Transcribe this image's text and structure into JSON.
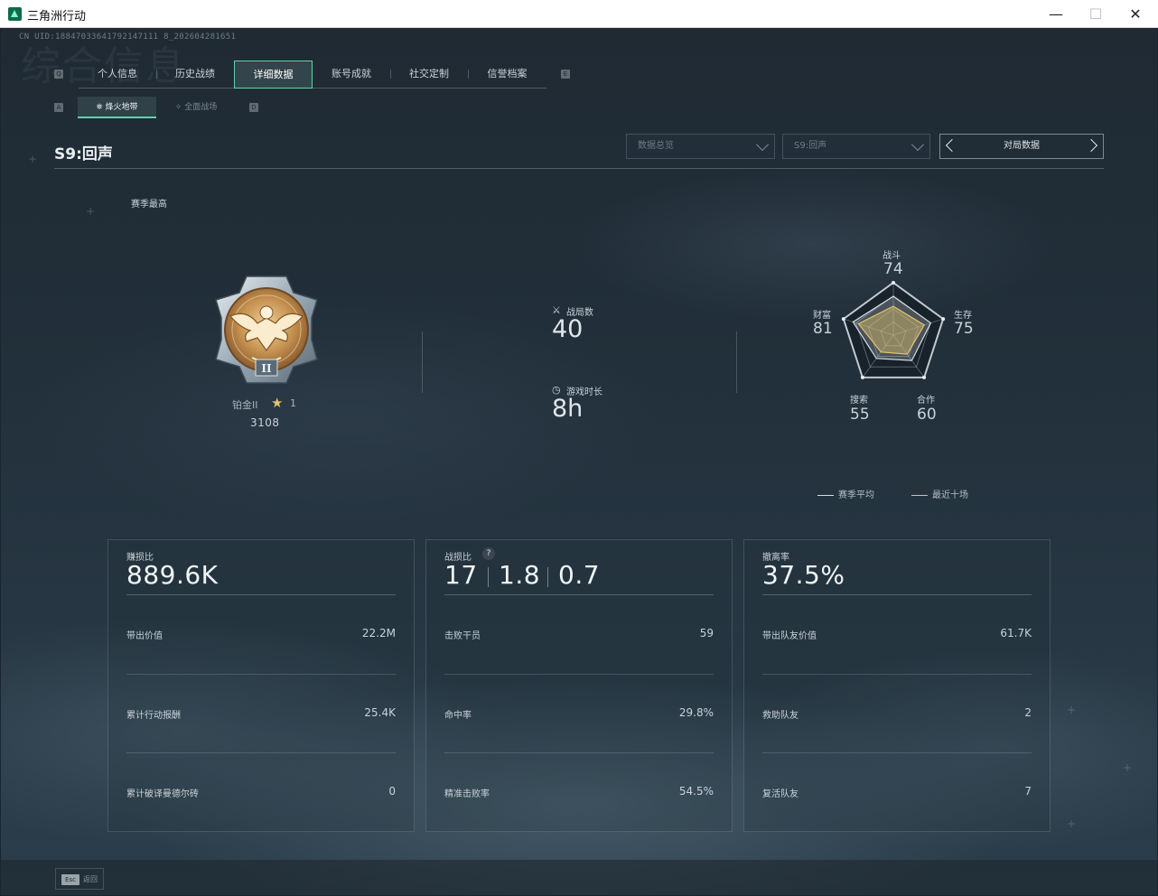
{
  "window": {
    "title": "三角洲行动",
    "min_glyph": "—",
    "max_glyph": "☐",
    "close_glyph": "✕"
  },
  "uid": "CN UID:18847033641792147111 8_202604281651",
  "bg_text": "综合信息",
  "nav": {
    "left_key": "Q",
    "right_key": "E",
    "tabs": [
      "个人信息",
      "历史战绩",
      "详细数据",
      "账号成就",
      "社交定制",
      "信誉档案"
    ],
    "active_index": 2
  },
  "subnav": {
    "left_key": "A",
    "right_key": "D",
    "tabs": [
      {
        "icon": "⛯",
        "label": "烽火地带"
      },
      {
        "icon": "✧",
        "label": "全面战场"
      }
    ],
    "active_index": 0
  },
  "season_title": "S9:回声",
  "filters": {
    "dropdown1": "数据总览",
    "dropdown2": "S9:回声",
    "pager_label": "对局数据"
  },
  "season_best_label": "赛季最高",
  "rank": {
    "name": "铂金II",
    "stars": "1",
    "score": "3108",
    "numeral": "II"
  },
  "overview": {
    "matches_label": "战局数",
    "matches_value": "40",
    "time_label": "游戏时长",
    "time_value": "8h"
  },
  "radar": {
    "axes": [
      {
        "label": "战斗",
        "value": "74"
      },
      {
        "label": "生存",
        "value": "75"
      },
      {
        "label": "合作",
        "value": "60"
      },
      {
        "label": "搜索",
        "value": "55"
      },
      {
        "label": "财富",
        "value": "81"
      }
    ],
    "season_avg": [
      74,
      75,
      60,
      55,
      81
    ],
    "recent_ten": [
      55,
      62,
      45,
      40,
      70
    ],
    "legend_season": "赛季平均",
    "legend_recent": "最近十场",
    "color_season": "#d7dde1",
    "color_recent": "#e0c36a"
  },
  "cards": [
    {
      "title": "赚损比",
      "big": "889.6K",
      "rows": [
        {
          "label": "带出价值",
          "value": "22.2M"
        },
        {
          "label": "累计行动报酬",
          "value": "25.4K"
        },
        {
          "label": "累计破译曼德尔砖",
          "value": "0"
        }
      ]
    },
    {
      "title": "战损比",
      "big_parts": [
        "17",
        "1.8",
        "0.7"
      ],
      "help": "?",
      "rows": [
        {
          "label": "击败干员",
          "value": "59"
        },
        {
          "label": "命中率",
          "value": "29.8%"
        },
        {
          "label": "精准击败率",
          "value": "54.5%"
        }
      ]
    },
    {
      "title": "撤离率",
      "big": "37.5%",
      "rows": [
        {
          "label": "带出队友价值",
          "value": "61.7K"
        },
        {
          "label": "救助队友",
          "value": "2"
        },
        {
          "label": "复活队友",
          "value": "7"
        }
      ]
    }
  ],
  "footer": {
    "esc_key": "Esc",
    "esc_label": "返回"
  },
  "colors": {
    "accent": "#5ad7a8",
    "gold": "#e0c36a"
  }
}
